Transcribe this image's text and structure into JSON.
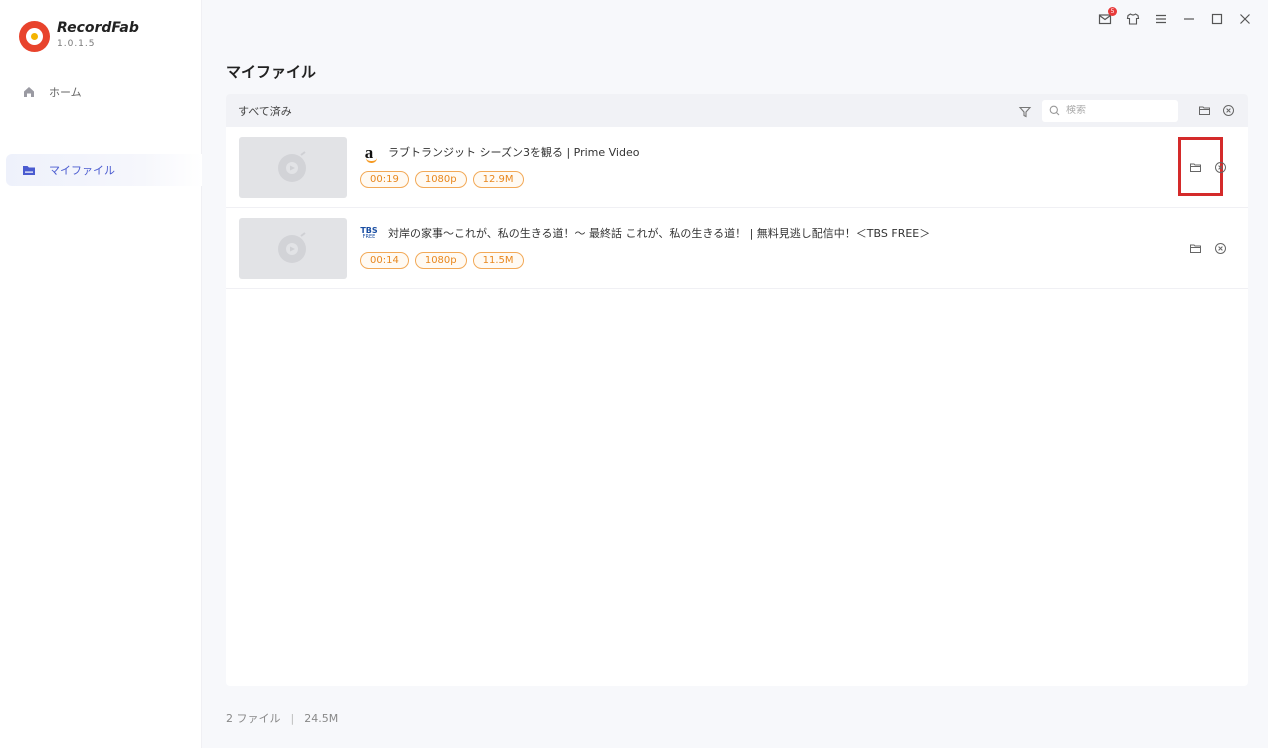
{
  "app": {
    "name": "RecordFab",
    "version": "1.0.1.5"
  },
  "sidebar": {
    "items": [
      {
        "label": "ホーム",
        "icon": "home-icon"
      },
      {
        "label": "マイファイル",
        "icon": "folder-icon"
      }
    ]
  },
  "window_controls": {
    "notification_badge": "5"
  },
  "page": {
    "title": "マイファイル"
  },
  "toolbar": {
    "label": "すべて済み",
    "search_placeholder": "検索"
  },
  "files": [
    {
      "source": "Amazon",
      "source_logo_text": "a",
      "title": "ラブトランジット シーズン3を観る | Prime Video",
      "duration": "00:19",
      "resolution": "1080p",
      "size": "12.9M"
    },
    {
      "source": "TBS FREE",
      "source_logo_text": "TBS",
      "source_logo_sub": "FREE",
      "title": "対岸の家事～これが、私の生きる道！～ 最終話 これが、私の生きる道！ | 無料見逃し配信中！＜TBS FREE＞",
      "duration": "00:14",
      "resolution": "1080p",
      "size": "11.5M"
    }
  ],
  "footer": {
    "count": "2 ファイル",
    "total_size": "24.5M"
  },
  "colors": {
    "accent": "#4a5bd0",
    "tag": "#e8871e",
    "highlight": "#d42a2a",
    "logo": "#e8432c"
  }
}
